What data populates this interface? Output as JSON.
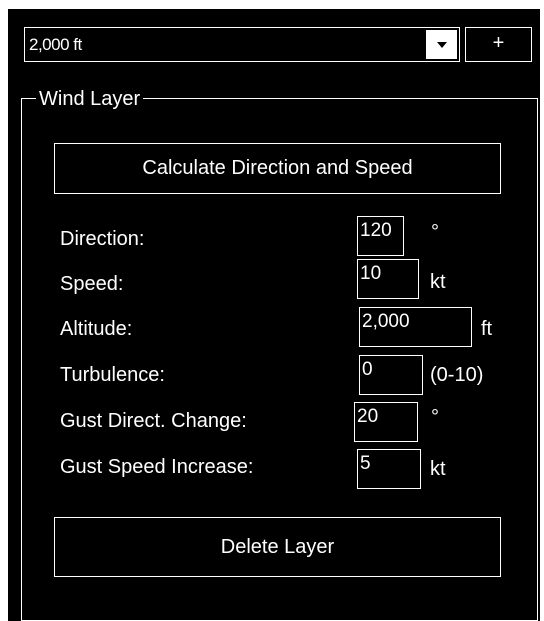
{
  "layer_select": {
    "value": "2,000 ft",
    "add_label": "+"
  },
  "wind_layer": {
    "title": "Wind Layer",
    "calculate_label": "Calculate Direction and Speed",
    "delete_label": "Delete Layer",
    "fields": [
      {
        "label": "Direction:",
        "value": "120",
        "unit": "°"
      },
      {
        "label": "Speed:",
        "value": "10",
        "unit": "kt"
      },
      {
        "label": "Altitude:",
        "value": "2,000",
        "unit": "ft"
      },
      {
        "label": "Turbulence:",
        "value": "0",
        "unit": "(0-10)"
      },
      {
        "label": "Gust Direct. Change:",
        "value": "20",
        "unit": "°"
      },
      {
        "label": "Gust Speed Increase:",
        "value": "5",
        "unit": "kt"
      }
    ]
  },
  "colors": {
    "background": "#000000",
    "foreground": "#ffffff"
  }
}
